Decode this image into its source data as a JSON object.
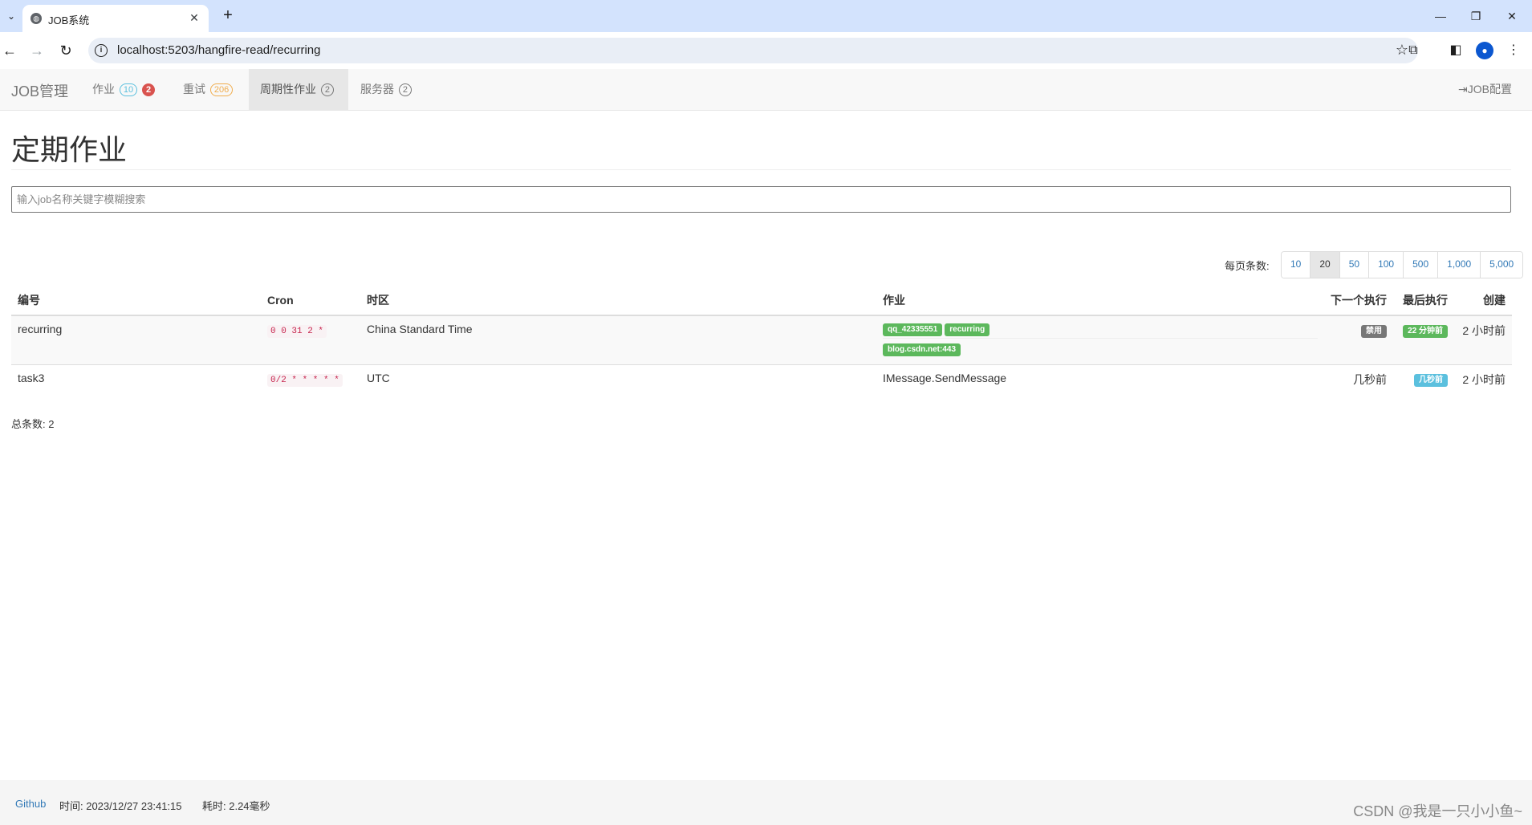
{
  "browser": {
    "tab_title": "JOB系统",
    "url": "localhost:5203/hangfire-read/recurring"
  },
  "navbar": {
    "brand": "JOB管理",
    "items": [
      {
        "label": "作业",
        "count": "10",
        "alert": "2"
      },
      {
        "label": "重试",
        "count": "206"
      },
      {
        "label": "周期性作业",
        "count": "2"
      },
      {
        "label": "服务器",
        "count": "2"
      }
    ],
    "config": "JOB配置"
  },
  "page": {
    "title": "定期作业",
    "search_placeholder": "输入job名称关键字模糊搜索"
  },
  "pager": {
    "label": "每页条数:",
    "options": [
      "10",
      "20",
      "50",
      "100",
      "500",
      "1,000",
      "5,000"
    ],
    "active": "20"
  },
  "table": {
    "headers": {
      "id": "编号",
      "cron": "Cron",
      "tz": "时区",
      "job": "作业",
      "next": "下一个执行",
      "last": "最后执行",
      "created": "创建"
    },
    "rows": [
      {
        "id": "recurring",
        "cron": "0 0 31 2 *",
        "tz": "China Standard Time",
        "job_labels": [
          "qq_42335551",
          "recurring",
          "blog.csdn.net:443"
        ],
        "next": "禁用",
        "last": "22 分钟前",
        "created": "2 小时前"
      },
      {
        "id": "task3",
        "cron": "0/2 * * * * *",
        "tz": "UTC",
        "job": "IMessage.SendMessage",
        "next": "几秒前",
        "last": "几秒前",
        "created": "2 小时前"
      }
    ]
  },
  "total": "总条数: 2",
  "footer": {
    "github": "Github",
    "time": "时间: 2023/12/27 23:41:15",
    "duration": "耗时: 2.24毫秒",
    "watermark": "CSDN @我是一只小小鱼~"
  },
  "colors": {
    "success": "#5cb85c",
    "info": "#5bc0de",
    "warning": "#f0ad4e",
    "danger": "#d9534f",
    "link": "#337ab7"
  }
}
